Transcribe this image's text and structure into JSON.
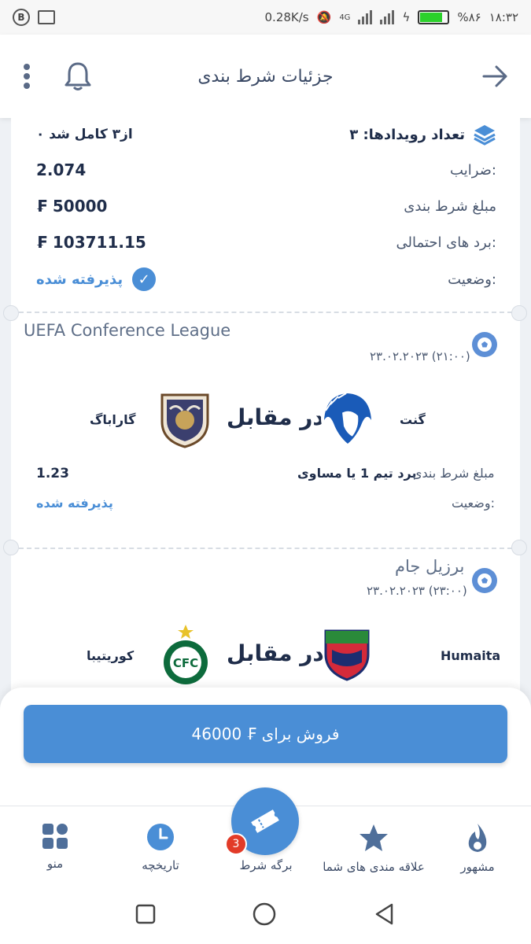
{
  "status_bar": {
    "speed": "0.28K/s",
    "network": "4G",
    "battery": "%۸۶",
    "time": "۱۸:۳۲"
  },
  "header": {
    "title": "جزئیات شرط بندی"
  },
  "summary": {
    "events_label": "تعداد رویدادها: ۳",
    "progress": "۰ از۳ کامل شد",
    "odds_label": "ضرایب:",
    "odds_value": "2.074",
    "stake_label": "مبلغ شرط بندی",
    "stake_value": "₣ 50000",
    "win_label": "برد های احتمالی:",
    "win_value": "₣ 103711.15",
    "status_label": "وضعیت:",
    "status_value": "پذیرفته شده"
  },
  "matches": [
    {
      "league": "UEFA Conference League",
      "date": "۲۳.۰۲.۲۰۲۳ (۲۱:۰۰)",
      "home": "گنت",
      "away": "گاراباگ",
      "vs": "در مقابل",
      "stake_label": "مبلغ شرط بندی",
      "pick": "برد تیم 1 یا مساوی",
      "odds": "1.23",
      "status_label": "وضعیت:",
      "status_value": "پذیرفته شده"
    },
    {
      "league": "برزیل جام",
      "date": "۲۳.۰۲.۲۰۲۳ (۲۳:۰۰)",
      "home": "Humaita",
      "away": "کوریتیبا",
      "vs": "در مقابل"
    }
  ],
  "sell_button": "فروش برای ₣ 46000",
  "bottom_nav": {
    "items": [
      {
        "label": "مشهور",
        "icon": "flame-icon"
      },
      {
        "label": "علاقه مندی های شما",
        "icon": "star-icon"
      },
      {
        "label": "برگه شرط",
        "icon": "ticket-icon"
      },
      {
        "label": "تاریخچه",
        "icon": "clock-icon"
      },
      {
        "label": "منو",
        "icon": "grid-icon"
      }
    ],
    "badge": "3"
  },
  "colors": {
    "accent": "#4a8ed6",
    "badge": "#e23b28",
    "text": "#1f2d4a"
  }
}
